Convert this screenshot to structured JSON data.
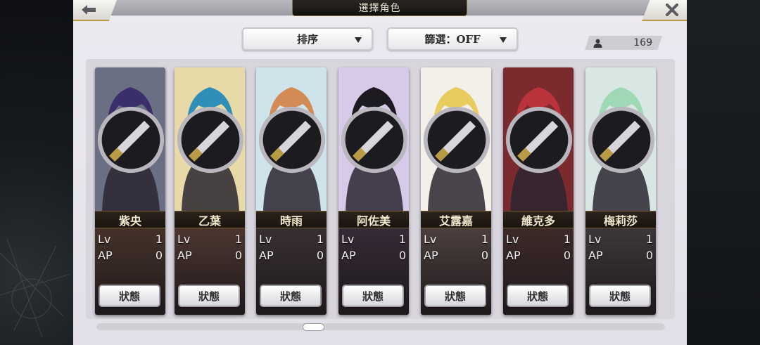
{
  "header": {
    "title": "選擇角色",
    "back_icon": "back-arrow-icon",
    "close_icon": "close-icon"
  },
  "toolbar": {
    "sort_label": "排序",
    "filter_label": "篩選：OFF",
    "character_count": "169",
    "count_icon": "person-icon"
  },
  "labels": {
    "lv": "Lv",
    "ap": "AP",
    "status_button": "狀態"
  },
  "characters": [
    {
      "name": "紫央",
      "lv": "1",
      "ap": "0",
      "hair": "#3a2f6a",
      "bg": "#6b6f84",
      "tint": "#5a3f2a"
    },
    {
      "name": "乙葉",
      "lv": "1",
      "ap": "0",
      "hair": "#2f8fb8",
      "bg": "#e8d9a8",
      "tint": "#6a4a3a"
    },
    {
      "name": "時雨",
      "lv": "1",
      "ap": "0",
      "hair": "#d48a55",
      "bg": "#cfe4ea",
      "tint": "#3f3a3a"
    },
    {
      "name": "阿佐美",
      "lv": "1",
      "ap": "0",
      "hair": "#1d1a22",
      "bg": "#d7c9e8",
      "tint": "#3a2f4a"
    },
    {
      "name": "艾露嘉",
      "lv": "1",
      "ap": "0",
      "hair": "#e9cc5e",
      "bg": "#f3f0ea",
      "tint": "#6a5d58"
    },
    {
      "name": "維克多",
      "lv": "1",
      "ap": "0",
      "hair": "#b8343a",
      "bg": "#7b2a2e",
      "tint": "#4a2f2a"
    },
    {
      "name": "梅莉莎",
      "lv": "1",
      "ap": "0",
      "hair": "#9fd8b5",
      "bg": "#d8e6e4",
      "tint": "#4a4a55"
    }
  ],
  "colors": {
    "accent_gold": "#b99a45",
    "panel_bg": "#e6e3eb"
  }
}
